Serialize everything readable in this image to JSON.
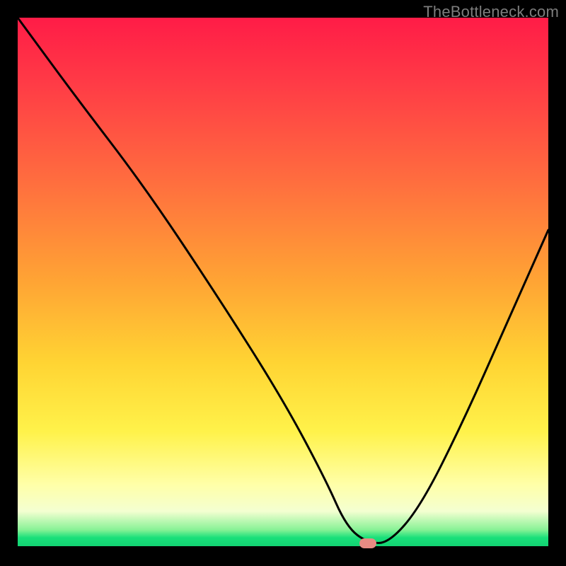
{
  "watermark": "TheBottleneck.com",
  "colors": {
    "frame": "#000000",
    "curve": "#000000",
    "marker": "#e78b83",
    "gradient_stops": [
      "#ff1c47",
      "#ff6b3f",
      "#ffd433",
      "#ffffa8",
      "#19e07a"
    ]
  },
  "chart_data": {
    "type": "line",
    "title": "",
    "xlabel": "",
    "ylabel": "",
    "xlim": [
      0,
      100
    ],
    "ylim": [
      0,
      100
    ],
    "grid": false,
    "legend": false,
    "note": "x and y are percentages of the plot area; y=0 is the bottom (green) and y=100 is the top (red). Curve traces bottleneck severity vs. an implicit x-axis; marker is the highlighted minimum.",
    "series": [
      {
        "name": "bottleneck-curve",
        "x": [
          0,
          11,
          24,
          38,
          50,
          58,
          62,
          66,
          70,
          76,
          84,
          92,
          100
        ],
        "y": [
          100,
          85,
          68,
          47,
          28,
          13,
          4,
          1,
          1,
          8,
          24,
          42,
          60
        ]
      }
    ],
    "marker": {
      "x": 66,
      "y": 1
    }
  }
}
